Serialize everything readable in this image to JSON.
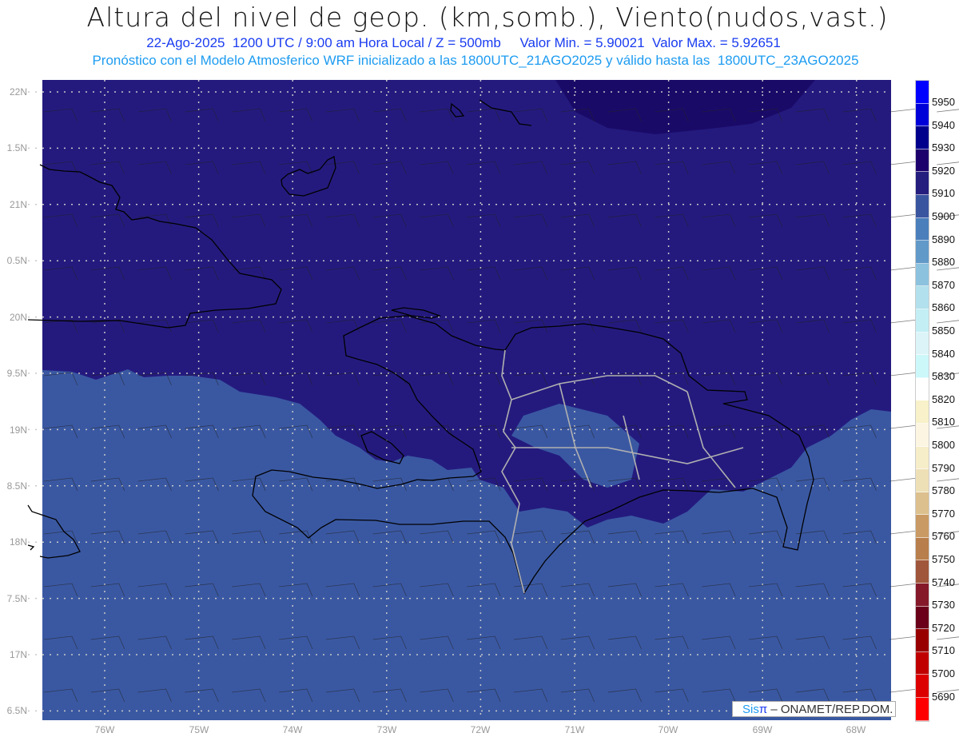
{
  "header": {
    "title": "Altura del nivel de geop. (km,somb.), Viento(nudos,vast.)",
    "subtitle1": "22-Ago-2025  1200 UTC / 9:00 am Hora Local / Z = 500mb     Valor Min. = 5.90021  Valor Max. = 5.92651",
    "subtitle2": "Pronóstico con el Modelo Atmosferico WRF inicializado a las 1800UTC_21AGO2025 y válido hasta las  1800UTC_23AGO2025"
  },
  "axes": {
    "lat_labels": [
      "22N",
      "1.5N",
      "21N",
      "0.5N",
      "20N",
      "9.5N",
      "19N",
      "8.5N",
      "18N",
      "7.5N",
      "17N",
      "6.5N"
    ],
    "lon_labels": [
      "76W",
      "75W",
      "74W",
      "73W",
      "72W",
      "71W",
      "70W",
      "69W",
      "68W"
    ]
  },
  "colorbar": {
    "labels": [
      "5950",
      "5940",
      "5930",
      "5920",
      "5910",
      "5900",
      "5890",
      "5880",
      "5870",
      "5860",
      "5850",
      "5840",
      "5830",
      "5820",
      "5810",
      "5800",
      "5790",
      "5780",
      "5770",
      "5760",
      "5750",
      "5740",
      "5730",
      "5720",
      "5710",
      "5700",
      "5690"
    ],
    "colors": [
      "#0000ff",
      "#0000d8",
      "#00008c",
      "#1c006c",
      "#251e7e",
      "#3a55a0",
      "#4a7fbb",
      "#6199c8",
      "#8cc2de",
      "#b2e0ec",
      "#c2eef4",
      "#dcf4f8",
      "#ccf8fa",
      "#ffffff",
      "#f8f1c9",
      "#fbf5e2",
      "#f6edc9",
      "#eee0b6",
      "#dcc08d",
      "#c99a63",
      "#b87e4b",
      "#a0563b",
      "#85192a",
      "#6a0019",
      "#980000",
      "#c00000",
      "#dc0000",
      "#ff0000"
    ]
  },
  "map_colors": {
    "low_field": "#3a58a2",
    "mid_field": "#241a7e",
    "high_field": "#1a0a68"
  },
  "credit": {
    "sis": "Sis",
    "pi": "π",
    "text": " – ONAMET/REP.DOM."
  }
}
